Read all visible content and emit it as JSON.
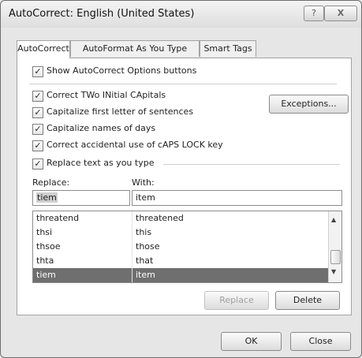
{
  "window": {
    "title": "AutoCorrect: English (United States)",
    "help": "?",
    "close": "X"
  },
  "tabs": [
    {
      "label": "AutoCorrect",
      "active": true
    },
    {
      "label": "AutoFormat As You Type",
      "active": false
    },
    {
      "label": "Smart Tags",
      "active": false
    }
  ],
  "options": {
    "show_buttons": {
      "label": "Show AutoCorrect Options buttons",
      "checked": true
    },
    "two_initials": {
      "label": "Correct TWo INitial CApitals",
      "checked": true
    },
    "first_letter": {
      "label": "Capitalize first letter of sentences",
      "checked": true
    },
    "names_of_days": {
      "label": "Capitalize names of days",
      "checked": true
    },
    "caps_lock": {
      "label": "Correct accidental use of cAPS LOCK key",
      "checked": true
    },
    "replace_text": {
      "label": "Replace text as you type",
      "checked": true
    }
  },
  "exceptions_button": "Exceptions...",
  "replace": {
    "label": "Replace:",
    "value": "tiem"
  },
  "with": {
    "label": "With:",
    "value": "item"
  },
  "list": [
    {
      "replace": "threatend",
      "with": "threatened",
      "selected": false
    },
    {
      "replace": "thsi",
      "with": "this",
      "selected": false
    },
    {
      "replace": "thsoe",
      "with": "those",
      "selected": false
    },
    {
      "replace": "thta",
      "with": "that",
      "selected": false
    },
    {
      "replace": "tiem",
      "with": "item",
      "selected": true
    }
  ],
  "buttons": {
    "replace": "Replace",
    "delete": "Delete",
    "ok": "OK",
    "close": "Close"
  },
  "checkmark": "✓",
  "scroll_up": "▲",
  "scroll_down": "▼"
}
